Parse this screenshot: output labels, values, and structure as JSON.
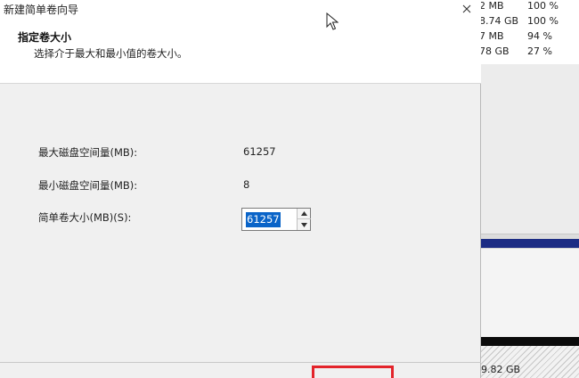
{
  "window": {
    "title": "新建简单卷向导"
  },
  "header": {
    "title": "指定卷大小",
    "subtitle": "选择介于最大和最小值的卷大小。"
  },
  "fields": [
    {
      "label": "最大磁盘空间量(MB):",
      "value": "61257"
    },
    {
      "label": "最小磁盘空间量(MB):",
      "value": "8"
    }
  ],
  "size_field": {
    "label": "简单卷大小(MB)(S):",
    "value": "61257"
  },
  "background_list": [
    {
      "size": "2 MB",
      "percent": "100 %"
    },
    {
      "size": "8.74 GB",
      "percent": "100 %"
    },
    {
      "size": "7 MB",
      "percent": "94 %"
    },
    {
      "size": "78 GB",
      "percent": "27 %"
    }
  ],
  "background_disk": {
    "partition_size": "9.82 GB"
  },
  "icons": {
    "close": "close-icon",
    "spin_up": "chevron-up-icon",
    "spin_down": "chevron-down-icon",
    "cursor": "mouse-cursor-icon"
  },
  "colors": {
    "selection": "#0a64c8",
    "highlight_box": "#e3242b",
    "disk_bar": "#1c2c84"
  }
}
